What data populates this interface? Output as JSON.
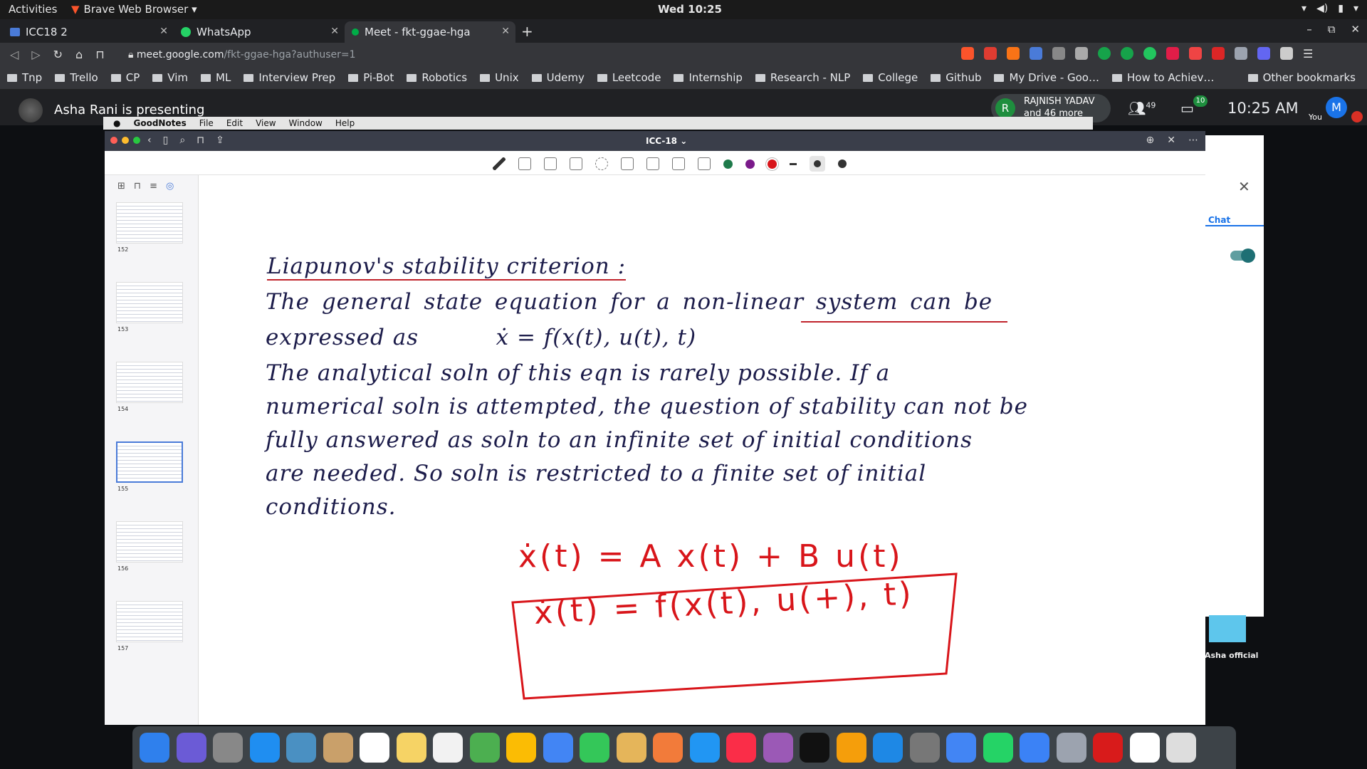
{
  "os_topbar": {
    "activities": "Activities",
    "browser_menu": "Brave Web Browser ▾",
    "clock": "Wed 10:25"
  },
  "tabs": [
    {
      "label": "ICC18 2",
      "icon": "meet-icon"
    },
    {
      "label": "WhatsApp",
      "icon": "whatsapp-icon"
    },
    {
      "label": "Meet - fkt-ggae-hga",
      "icon": "meet-icon"
    }
  ],
  "address": {
    "host": "meet.google.com",
    "path": "/fkt-ggae-hga?authuser=1"
  },
  "bookmarks": [
    "Tnp",
    "Trello",
    "CP",
    "Vim",
    "ML",
    "Interview Prep",
    "Pi-Bot",
    "Robotics",
    "Unix",
    "Udemy",
    "Leetcode",
    "Internship",
    "Research - NLP",
    "College",
    "Github",
    "My Drive - Goo…",
    "How to Achiev…"
  ],
  "other_bookmarks": "Other bookmarks",
  "meet": {
    "presenting": "Asha Rani is presenting",
    "participant_initial": "R",
    "participant_name": "RAJNISH YADAV",
    "participant_more": "and 46 more",
    "people_count": "49",
    "chat_count": "10",
    "time": "10:25 AM",
    "you_initial": "M",
    "you_label": "You",
    "chat_tab": "Chat",
    "tile_name": "Asha official"
  },
  "mac_menubar": {
    "app": "GoodNotes",
    "menus": [
      "File",
      "Edit",
      "View",
      "Window",
      "Help"
    ]
  },
  "goodnotes": {
    "title": "ICC-18 ⌄",
    "pages": [
      "152",
      "153",
      "154",
      "155",
      "156",
      "157"
    ],
    "selected_page": "155",
    "ink_colors": [
      "#1e7a4a",
      "#7a1a8a",
      "#d8151a"
    ]
  },
  "notes": {
    "heading": "Liapunov's stability criterion :",
    "lines": [
      "The general state equation for a non-linear system can be",
      "expressed as          ẋ = f(x(t), u(t), t)",
      "The analytical soln of this eqn is rarely possible. If a",
      "numerical soln is attempted, the question of stability can not be",
      "fully answered as soln to an infinite set of initial conditions",
      "are needed. So soln is restricted to a finite set of initial",
      "conditions."
    ],
    "eq1": "ẋ(t) = A x(t) + B u(t)",
    "eq2": "ẋ(t) = f(x(t), u(+), t)"
  }
}
